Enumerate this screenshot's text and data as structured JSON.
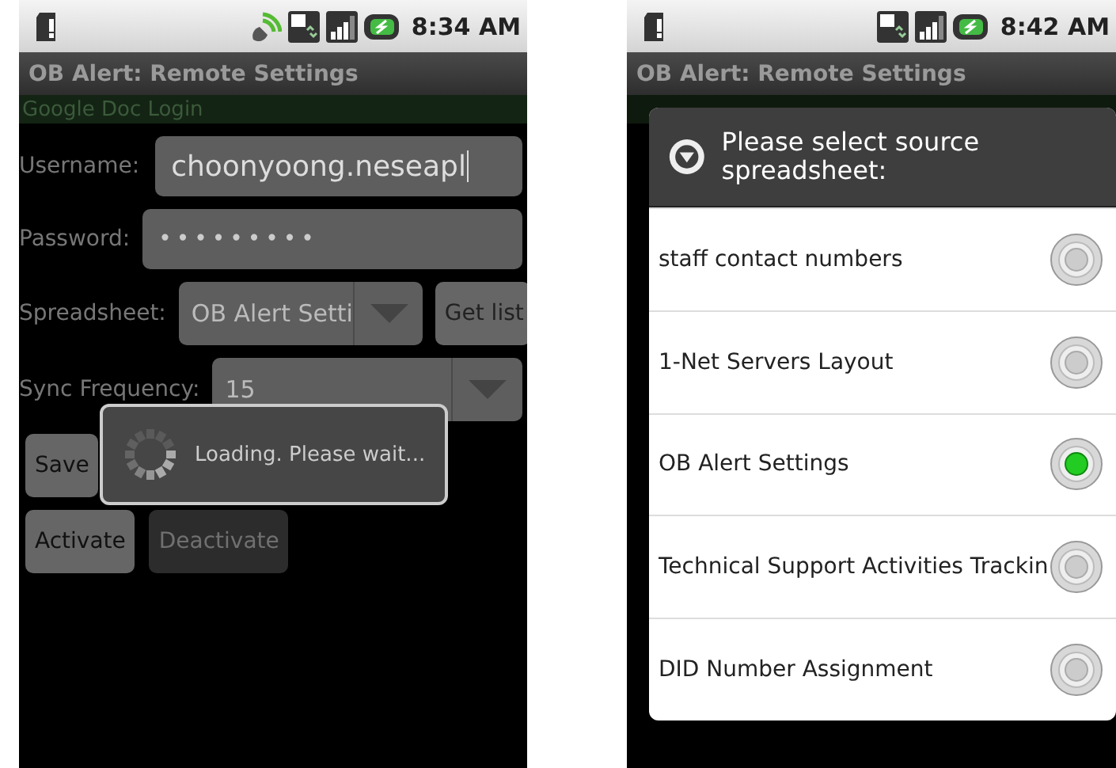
{
  "left_screen": {
    "status_bar": {
      "time": "8:34 AM",
      "wifi": true
    },
    "title": "OB Alert: Remote Settings",
    "section": "Google Doc Login",
    "username": {
      "label": "Username:",
      "value": "choonyoong.neseapl"
    },
    "password": {
      "label": "Password:",
      "value": "•••••••••"
    },
    "spreadsheet": {
      "label": "Spreadsheet:",
      "value": "OB Alert Setti",
      "button": "Get list"
    },
    "sync_frequency": {
      "label": "Sync Frequency:",
      "value": "15"
    },
    "button_rows": [
      {
        "buttons": [
          {
            "label": "Save",
            "disabled": false
          }
        ]
      },
      {
        "buttons": [
          {
            "label": "Activate",
            "disabled": false
          },
          {
            "label": "Deactivate",
            "disabled": true
          }
        ]
      }
    ],
    "loading_dialog": {
      "message": "Loading. Please wait..."
    }
  },
  "right_screen": {
    "status_bar": {
      "time": "8:42 AM",
      "wifi": false
    },
    "title": "OB Alert: Remote Settings",
    "dialog": {
      "title": "Please select source spreadsheet:",
      "options": [
        {
          "label": "staff contact numbers",
          "selected": false
        },
        {
          "label": "1-Net Servers Layout",
          "selected": false
        },
        {
          "label": "OB Alert Settings",
          "selected": true
        },
        {
          "label": "Technical Support Activities Trackin",
          "selected": false
        },
        {
          "label": "DID Number Assignment",
          "selected": false
        }
      ]
    }
  }
}
